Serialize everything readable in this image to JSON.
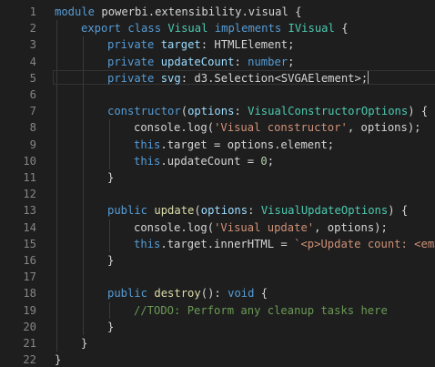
{
  "editor": {
    "language": "typescript",
    "cursor_line": 5,
    "lines": [
      {
        "n": "1",
        "indent": 0,
        "tokens": [
          [
            "kw",
            "module"
          ],
          [
            "txt",
            " powerbi.extensibility.visual {"
          ]
        ]
      },
      {
        "n": "2",
        "indent": 1,
        "tokens": [
          [
            "kw",
            "export"
          ],
          [
            "txt",
            " "
          ],
          [
            "kw",
            "class"
          ],
          [
            "txt",
            " "
          ],
          [
            "type",
            "Visual"
          ],
          [
            "txt",
            " "
          ],
          [
            "kw",
            "implements"
          ],
          [
            "txt",
            " "
          ],
          [
            "type",
            "IVisual"
          ],
          [
            "txt",
            " {"
          ]
        ]
      },
      {
        "n": "3",
        "indent": 2,
        "tokens": [
          [
            "kw",
            "private"
          ],
          [
            "txt",
            " "
          ],
          [
            "prop",
            "target"
          ],
          [
            "txt",
            ": HTMLElement;"
          ]
        ]
      },
      {
        "n": "4",
        "indent": 2,
        "tokens": [
          [
            "kw",
            "private"
          ],
          [
            "txt",
            " "
          ],
          [
            "prop",
            "updateCount"
          ],
          [
            "txt",
            ": "
          ],
          [
            "kw",
            "number"
          ],
          [
            "txt",
            ";"
          ]
        ]
      },
      {
        "n": "5",
        "indent": 2,
        "tokens": [
          [
            "kw",
            "private"
          ],
          [
            "txt",
            " "
          ],
          [
            "prop",
            "svg"
          ],
          [
            "txt",
            ": d3.Selection<SVGAElement>;"
          ]
        ]
      },
      {
        "n": "6",
        "indent": 0,
        "tokens": []
      },
      {
        "n": "7",
        "indent": 2,
        "tokens": [
          [
            "kw",
            "constructor"
          ],
          [
            "txt",
            "("
          ],
          [
            "prop",
            "options"
          ],
          [
            "txt",
            ": "
          ],
          [
            "type",
            "VisualConstructorOptions"
          ],
          [
            "txt",
            ") {"
          ]
        ]
      },
      {
        "n": "8",
        "indent": 3,
        "tokens": [
          [
            "txt",
            "console.log("
          ],
          [
            "str",
            "'Visual constructor'"
          ],
          [
            "txt",
            ", options);"
          ]
        ]
      },
      {
        "n": "9",
        "indent": 3,
        "tokens": [
          [
            "kw",
            "this"
          ],
          [
            "txt",
            ".target = options.element;"
          ]
        ]
      },
      {
        "n": "10",
        "indent": 3,
        "tokens": [
          [
            "kw",
            "this"
          ],
          [
            "txt",
            ".updateCount = "
          ],
          [
            "num",
            "0"
          ],
          [
            "txt",
            ";"
          ]
        ]
      },
      {
        "n": "11",
        "indent": 2,
        "tokens": [
          [
            "txt",
            "}"
          ]
        ]
      },
      {
        "n": "12",
        "indent": 0,
        "tokens": []
      },
      {
        "n": "13",
        "indent": 2,
        "tokens": [
          [
            "kw",
            "public"
          ],
          [
            "txt",
            " "
          ],
          [
            "fn",
            "update"
          ],
          [
            "txt",
            "("
          ],
          [
            "prop",
            "options"
          ],
          [
            "txt",
            ": "
          ],
          [
            "type",
            "VisualUpdateOptions"
          ],
          [
            "txt",
            ") {"
          ]
        ]
      },
      {
        "n": "14",
        "indent": 3,
        "tokens": [
          [
            "txt",
            "console.log("
          ],
          [
            "str",
            "'Visual update'"
          ],
          [
            "txt",
            ", options);"
          ]
        ]
      },
      {
        "n": "15",
        "indent": 3,
        "tokens": [
          [
            "kw",
            "this"
          ],
          [
            "txt",
            ".target.innerHTML = "
          ],
          [
            "str",
            "`<p>Update count: <em>"
          ]
        ]
      },
      {
        "n": "16",
        "indent": 2,
        "tokens": [
          [
            "txt",
            "}"
          ]
        ]
      },
      {
        "n": "17",
        "indent": 0,
        "tokens": []
      },
      {
        "n": "18",
        "indent": 2,
        "tokens": [
          [
            "kw",
            "public"
          ],
          [
            "txt",
            " "
          ],
          [
            "fn",
            "destroy"
          ],
          [
            "txt",
            "(): "
          ],
          [
            "kw",
            "void"
          ],
          [
            "txt",
            " {"
          ]
        ]
      },
      {
        "n": "19",
        "indent": 3,
        "tokens": [
          [
            "com",
            "//TODO: Perform any cleanup tasks here"
          ]
        ]
      },
      {
        "n": "20",
        "indent": 2,
        "tokens": [
          [
            "txt",
            "}"
          ]
        ]
      },
      {
        "n": "21",
        "indent": 1,
        "tokens": [
          [
            "txt",
            "}"
          ]
        ]
      },
      {
        "n": "22",
        "indent": 0,
        "tokens": [
          [
            "txt",
            "}"
          ]
        ]
      }
    ]
  }
}
